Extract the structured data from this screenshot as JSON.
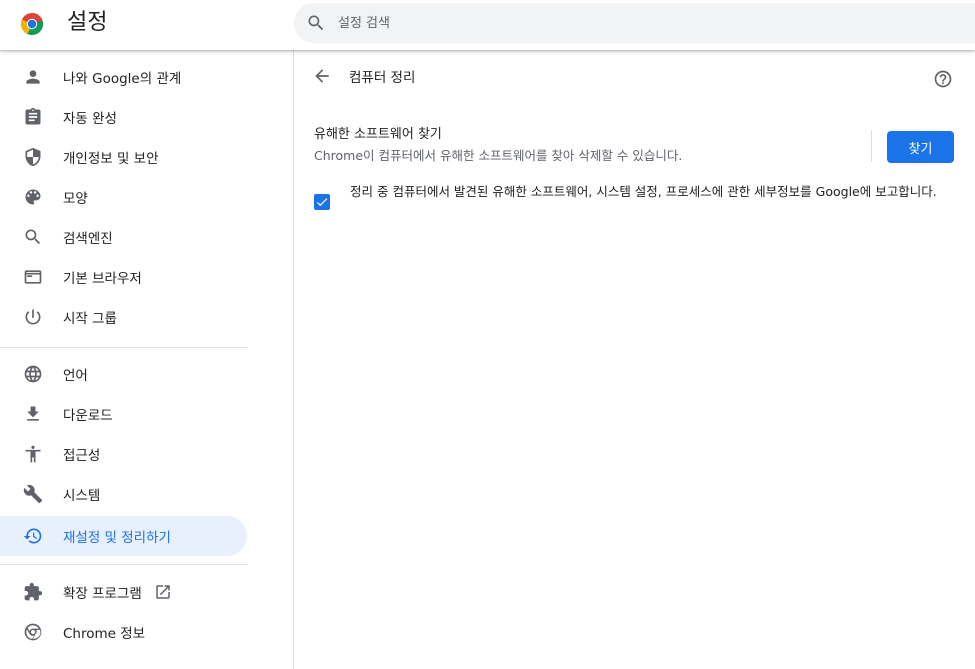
{
  "header": {
    "title": "설정",
    "logo_icon": "chrome-logo-icon",
    "search": {
      "placeholder": "설정 검색",
      "value": "",
      "icon": "search-icon"
    }
  },
  "sidebar": {
    "groups": [
      [
        {
          "label": "나와 Google의 관계",
          "icon": "person-icon",
          "active": false
        },
        {
          "label": "자동 완성",
          "icon": "clipboard-icon",
          "active": false
        },
        {
          "label": "개인정보 및 보안",
          "icon": "shield-icon",
          "active": false
        },
        {
          "label": "모양",
          "icon": "palette-icon",
          "active": false
        },
        {
          "label": "검색엔진",
          "icon": "search-icon",
          "active": false
        },
        {
          "label": "기본 브라우저",
          "icon": "browser-icon",
          "active": false
        },
        {
          "label": "시작 그룹",
          "icon": "power-icon",
          "active": false
        }
      ],
      [
        {
          "label": "언어",
          "icon": "globe-icon",
          "active": false
        },
        {
          "label": "다운로드",
          "icon": "download-icon",
          "active": false
        },
        {
          "label": "접근성",
          "icon": "accessibility-icon",
          "active": false
        },
        {
          "label": "시스템",
          "icon": "wrench-icon",
          "active": false
        },
        {
          "label": "재설정 및 정리하기",
          "icon": "restore-icon",
          "active": true
        }
      ],
      [
        {
          "label": "확장 프로그램",
          "icon": "puzzle-icon",
          "active": false,
          "external": true,
          "external_icon": "open-in-new-icon"
        },
        {
          "label": "Chrome 정보",
          "icon": "chrome-icon",
          "active": false
        }
      ]
    ]
  },
  "main": {
    "title": "컴퓨터 정리",
    "back_icon": "arrow-back-icon",
    "help_icon": "help-icon",
    "find_row": {
      "title": "유해한 소프트웨어 찾기",
      "description": "Chrome이 컴퓨터에서 유해한 소프트웨어를 찾아 삭제할 수 있습니다.",
      "button_label": "찾기"
    },
    "report": {
      "checked": true,
      "label": "정리 중 컴퓨터에서 발견된 유해한 소프트웨어, 시스템 설정, 프로세스에 관한 세부정보를 Google에 보고합니다."
    }
  },
  "colors": {
    "accent": "#1a73e8",
    "active_bg": "#e8f0fe",
    "text_primary": "#202124",
    "text_secondary": "#5f6368"
  }
}
